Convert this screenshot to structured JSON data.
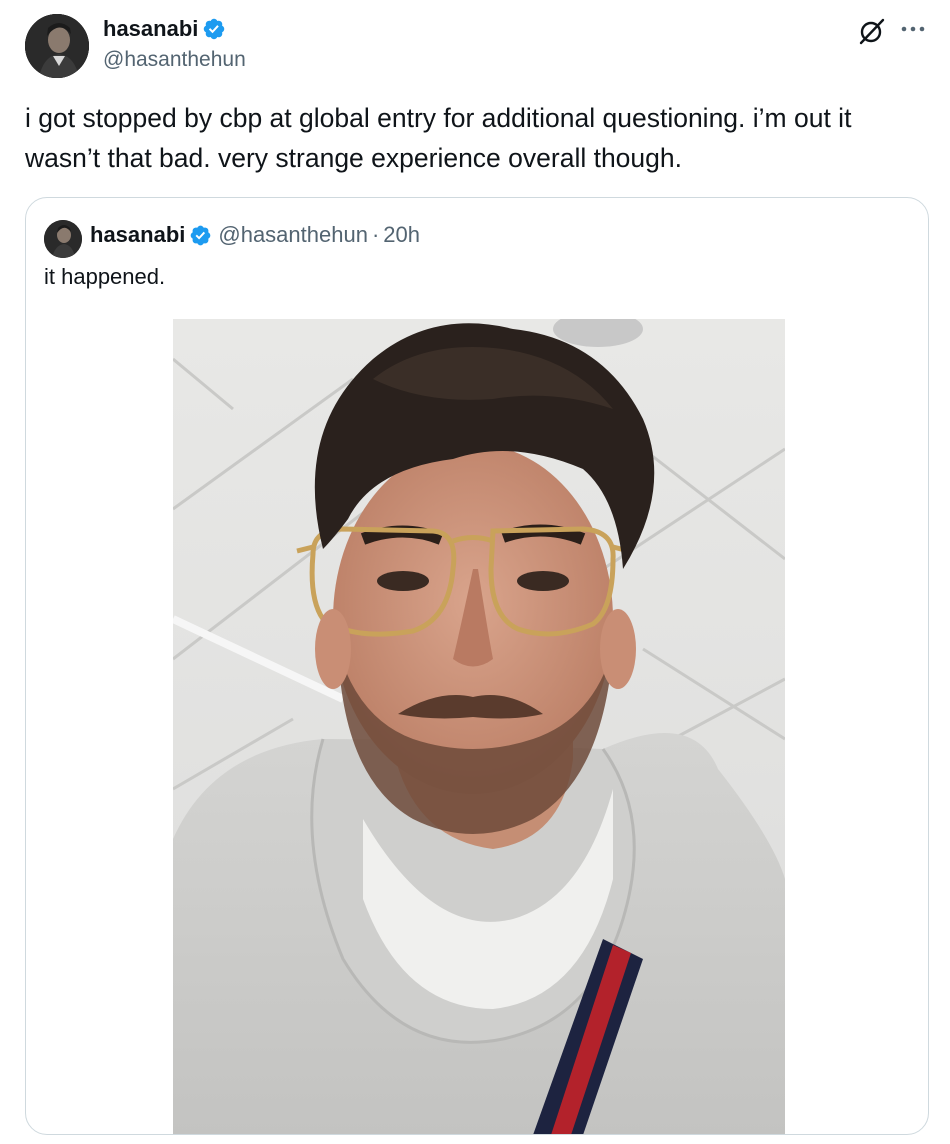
{
  "author": {
    "display_name": "hasanabi",
    "handle": "@hasanthehun",
    "verified": true,
    "avatar_icon": "profile-photo"
  },
  "tweet": {
    "text": "i got stopped by cbp at global entry for additional questioning. i’m out it\nwasn’t that bad. very strange experience overall though."
  },
  "actions": {
    "grok_icon": "grok-icon",
    "more_icon": "more-options-icon"
  },
  "quoted_tweet": {
    "display_name": "hasanabi",
    "handle": "@hasanthehun",
    "separator": "·",
    "time": "20h",
    "text": "it happened.",
    "media": "selfie-photo"
  },
  "colors": {
    "text_primary": "#0f1419",
    "text_secondary": "#536471",
    "verified_blue": "#1d9bf0",
    "border": "#cfd9de"
  }
}
